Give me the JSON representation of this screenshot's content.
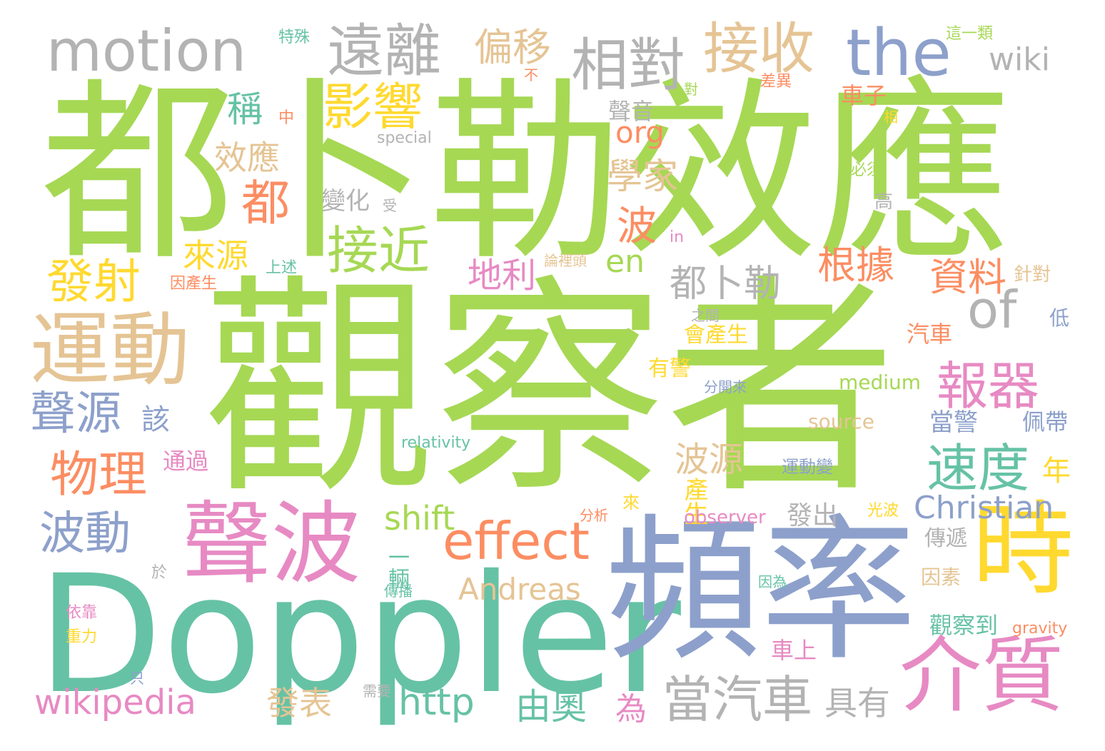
{
  "words": [
    {
      "text": "觀察者",
      "color": "#a6d854"
    },
    {
      "text": "都卜勒效應",
      "color": "#a6d854"
    },
    {
      "text": "Doppler",
      "color": "#66c2a5"
    },
    {
      "text": "頻率",
      "color": "#8da0cb"
    },
    {
      "text": "聲波",
      "color": "#e78ac3"
    },
    {
      "text": "motion",
      "color": "#b3b3b3"
    },
    {
      "text": "運動",
      "color": "#e5c494"
    },
    {
      "text": "時",
      "color": "#ffd92f"
    },
    {
      "text": "介質",
      "color": "#e78ac3"
    },
    {
      "text": "遠離",
      "color": "#b3b3b3"
    },
    {
      "text": "相對",
      "color": "#b3b3b3"
    },
    {
      "text": "接收",
      "color": "#e5c494"
    },
    {
      "text": "the",
      "color": "#8da0cb"
    },
    {
      "text": "effect",
      "color": "#fc8d62"
    },
    {
      "text": "of",
      "color": "#b3b3b3"
    },
    {
      "text": "影響",
      "color": "#ffd92f"
    },
    {
      "text": "接近",
      "color": "#a6d854"
    },
    {
      "text": "報器",
      "color": "#e78ac3"
    },
    {
      "text": "速度",
      "color": "#66c2a5"
    },
    {
      "text": "物理",
      "color": "#fc8d62"
    },
    {
      "text": "發射",
      "color": "#ffd92f"
    },
    {
      "text": "聲源",
      "color": "#8da0cb"
    },
    {
      "text": "波動",
      "color": "#8da0cb"
    },
    {
      "text": "當汽車",
      "color": "#b3b3b3"
    },
    {
      "text": "Christian",
      "color": "#8da0cb"
    },
    {
      "text": "wikipedia",
      "color": "#e78ac3"
    },
    {
      "text": "http",
      "color": "#66c2a5"
    },
    {
      "text": "Andreas",
      "color": "#e5c494"
    },
    {
      "text": "偏移",
      "color": "#e5c494"
    },
    {
      "text": "wiki",
      "color": "#b3b3b3"
    },
    {
      "text": "shift",
      "color": "#a6d854"
    },
    {
      "text": "資料",
      "color": "#fc8d62"
    },
    {
      "text": "根據",
      "color": "#fc8d62"
    },
    {
      "text": "都卜勒",
      "color": "#b3b3b3"
    },
    {
      "text": "en",
      "color": "#a6d854"
    },
    {
      "text": "org",
      "color": "#fc8d62"
    },
    {
      "text": "學家",
      "color": "#e5c494"
    },
    {
      "text": "地利",
      "color": "#e78ac3"
    },
    {
      "text": "波源",
      "color": "#e5c494"
    },
    {
      "text": "由奧",
      "color": "#66c2a5"
    },
    {
      "text": "發表",
      "color": "#e5c494"
    },
    {
      "text": "具有",
      "color": "#b3b3b3"
    },
    {
      "text": "來源",
      "color": "#ffd92f"
    },
    {
      "text": "效應",
      "color": "#e5c494"
    },
    {
      "text": "聲音",
      "color": "#b3b3b3"
    },
    {
      "text": "稱",
      "color": "#66c2a5"
    },
    {
      "text": "都",
      "color": "#fc8d62"
    },
    {
      "text": "該",
      "color": "#8da0cb"
    },
    {
      "text": "波",
      "color": "#fc8d62"
    },
    {
      "text": "為",
      "color": "#e78ac3"
    },
    {
      "text": "年",
      "color": "#ffd92f"
    },
    {
      "text": "變化",
      "color": "#b3b3b3"
    },
    {
      "text": "一輛",
      "color": "#66c2a5"
    },
    {
      "text": "發出",
      "color": "#b3b3b3"
    },
    {
      "text": "產生",
      "color": "#ffd92f"
    },
    {
      "text": "當警",
      "color": "#8da0cb"
    },
    {
      "text": "佩帶",
      "color": "#8da0cb"
    },
    {
      "text": "觀察到",
      "color": "#66c2a5"
    },
    {
      "text": "車子",
      "color": "#fc8d62"
    },
    {
      "text": "汽車",
      "color": "#fc8d62"
    },
    {
      "text": "通過",
      "color": "#e78ac3"
    },
    {
      "text": "會產生",
      "color": "#ffd92f"
    },
    {
      "text": "有警",
      "color": "#ffd92f"
    },
    {
      "text": "medium",
      "color": "#a6d854"
    },
    {
      "text": "source",
      "color": "#e5c494"
    },
    {
      "text": "observer",
      "color": "#e78ac3"
    },
    {
      "text": "relativity",
      "color": "#66c2a5"
    },
    {
      "text": "運動變",
      "color": "#8da0cb"
    },
    {
      "text": "special",
      "color": "#b3b3b3"
    },
    {
      "text": "傳遞",
      "color": "#b3b3b3"
    },
    {
      "text": "因素",
      "color": "#e5c494"
    },
    {
      "text": "光波",
      "color": "#ffd92f"
    },
    {
      "text": "gravity",
      "color": "#fc8d62"
    },
    {
      "text": "車上",
      "color": "#e78ac3"
    },
    {
      "text": "上述",
      "color": "#66c2a5"
    },
    {
      "text": "因產生",
      "color": "#fc8d62"
    },
    {
      "text": "論裡頭",
      "color": "#e5c494"
    },
    {
      "text": "分開來",
      "color": "#8da0cb"
    },
    {
      "text": "之間",
      "color": "#b3b3b3"
    },
    {
      "text": "針對",
      "color": "#e5c494"
    },
    {
      "text": "低",
      "color": "#8da0cb"
    },
    {
      "text": "高",
      "color": "#b3b3b3"
    },
    {
      "text": "必須",
      "color": "#a6d854"
    },
    {
      "text": "in",
      "color": "#e78ac3"
    },
    {
      "text": "特殊",
      "color": "#66c2a5"
    },
    {
      "text": "這一類",
      "color": "#a6d854"
    },
    {
      "text": "不",
      "color": "#fc8d62"
    },
    {
      "text": "對",
      "color": "#a6d854"
    },
    {
      "text": "差異",
      "color": "#fc8d62"
    },
    {
      "text": "相",
      "color": "#ffd92f"
    },
    {
      "text": "中",
      "color": "#fc8d62"
    },
    {
      "text": "受",
      "color": "#b3b3b3"
    },
    {
      "text": "來",
      "color": "#ffd92f"
    },
    {
      "text": "分析",
      "color": "#fc8d62"
    },
    {
      "text": "於",
      "color": "#b3b3b3"
    },
    {
      "text": "傳播",
      "color": "#66c2a5"
    },
    {
      "text": "因為",
      "color": "#66c2a5"
    },
    {
      "text": "依靠",
      "color": "#e78ac3"
    },
    {
      "text": "重力",
      "color": "#ffd92f"
    },
    {
      "text": "只",
      "color": "#8da0cb"
    },
    {
      "text": "需要",
      "color": "#b3b3b3"
    }
  ]
}
